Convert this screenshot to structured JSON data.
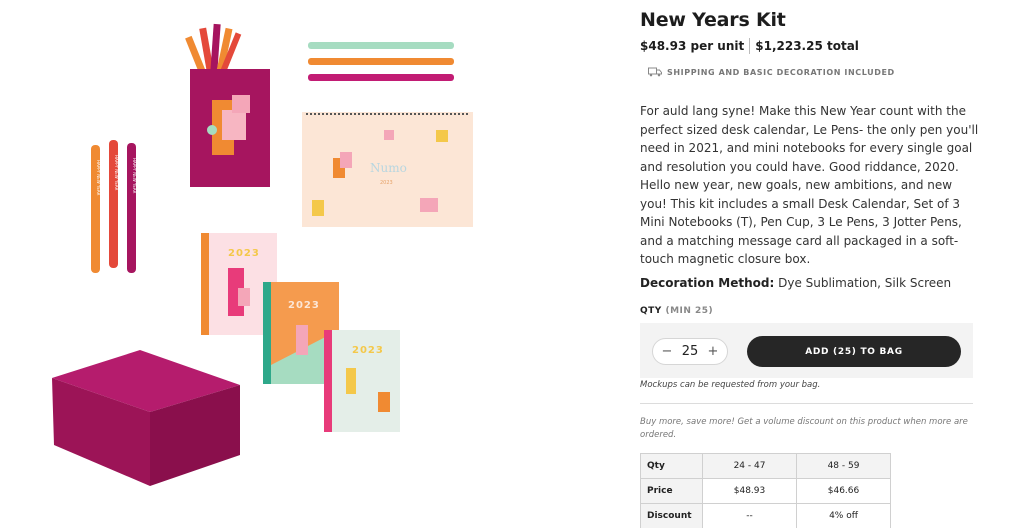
{
  "product": {
    "title": "New Years Kit",
    "unit_price": "$48.93 per unit",
    "total_price": "$1,223.25 total",
    "shipping_note": "SHIPPING AND BASIC DECORATION INCLUDED",
    "description": "For auld lang syne! Make this New Year count with the perfect sized desk calendar, Le Pens- the only pen you'll need in 2021, and mini notebooks for every single goal and resolution you could have. Good riddance, 2020. Hello new year, new goals, new ambitions, and new you! This kit includes a small Desk Calendar, Set of 3 Mini Notebooks (T), Pen Cup, 3 Le Pens, 3 Jotter Pens, and a matching message card all packaged in a soft-touch magnetic closure box.",
    "decoration_label": "Decoration Method:",
    "decoration_value": " Dye Sublimation, Silk Screen"
  },
  "image_text": {
    "calendar_logo": "Numo",
    "calendar_year": "2023",
    "notebook_1_year": "2023",
    "notebook_2_year": "2023",
    "notebook_3_year": "2023",
    "pen_text_1": "HAPPY NEW YEAR",
    "pen_text_2": "HAPPY NEW YEAR",
    "pen_text_3": "HAPPY NEW YEAR"
  },
  "qty": {
    "label": "QTY",
    "min": "(MIN 25)",
    "value": "25",
    "decrement": "−",
    "increment": "+",
    "add_button": "ADD (25) TO BAG"
  },
  "notes": {
    "mockup": "Mockups can be requested from your bag.",
    "volume": "Buy more, save more! Get a volume discount on this product when more are ordered."
  },
  "pricing_table": {
    "headers": [
      "Qty",
      "24 - 47",
      "48 - 59"
    ],
    "rows": [
      [
        "Price",
        "$48.93",
        "$46.66"
      ],
      [
        "Discount",
        "--",
        "4% off"
      ]
    ]
  },
  "colors": {
    "magenta": "#a6155f",
    "orange": "#f08a32",
    "pink": "#f4a6b8",
    "mint": "#a6dcc1",
    "peach": "#fce6d6",
    "button": "#262626"
  },
  "icons": {
    "shipping": "truck-icon"
  }
}
